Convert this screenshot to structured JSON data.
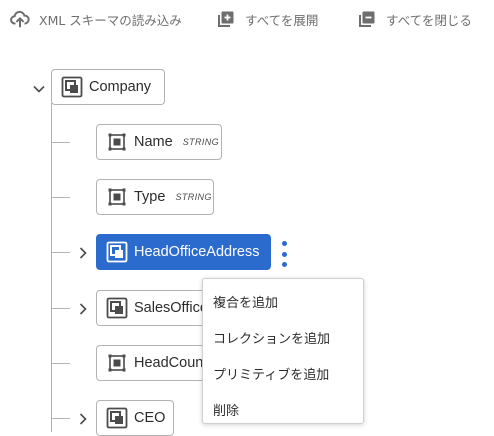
{
  "toolbar": {
    "import_label": "XML スキーマの読み込み",
    "expand_label": "すべてを展開",
    "collapse_label": "すべてを閉じる"
  },
  "tree": {
    "root": {
      "label": "Company",
      "expanded": true
    },
    "children": [
      {
        "label": "Name",
        "type": "STRING",
        "kind": "primitive"
      },
      {
        "label": "Type",
        "type": "STRING",
        "kind": "primitive"
      },
      {
        "label": "HeadOfficeAddress",
        "kind": "complex",
        "selected": true
      },
      {
        "label": "SalesOffices",
        "kind": "complex"
      },
      {
        "label": "HeadCount",
        "kind": "primitive"
      },
      {
        "label": "CEO",
        "kind": "complex"
      }
    ]
  },
  "context_menu": {
    "items": [
      "複合を追加",
      "コレクションを追加",
      "プリミティブを追加",
      "削除"
    ]
  },
  "colors": {
    "accent": "#2c6bce",
    "toolbar_text": "#6e6e6e",
    "tree_line": "#b3b3b3"
  },
  "icons": [
    "upload-cloud-icon",
    "expand-all-icon",
    "collapse-all-icon",
    "chevron-down-icon",
    "chevron-right-icon",
    "complex-node-icon",
    "primitive-node-icon",
    "more-vertical-icon"
  ]
}
